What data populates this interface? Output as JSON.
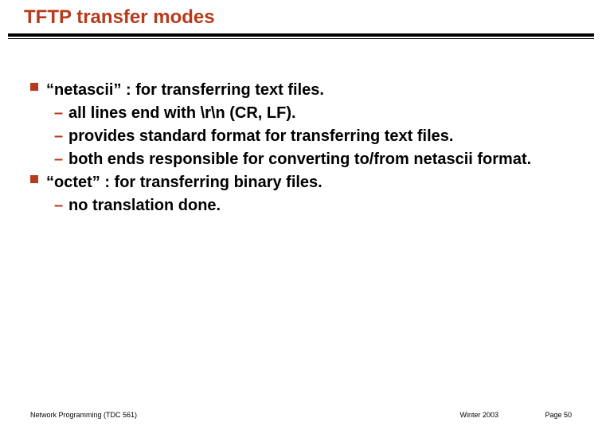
{
  "title": "TFTP transfer modes",
  "bullets": {
    "b1": "“netascii” :  for transferring text files.",
    "b1_s1": "all lines end with \\r\\n (CR, LF).",
    "b1_s2": "provides standard format for transferring text files.",
    "b1_s3": "both ends responsible for converting to/from netascii format.",
    "b2": "“octet” : for transferring binary files.",
    "b2_s1": "no translation done."
  },
  "footer": {
    "left": "Network Programming (TDC 561)",
    "mid": "Winter  2003",
    "right": "Page 50"
  }
}
